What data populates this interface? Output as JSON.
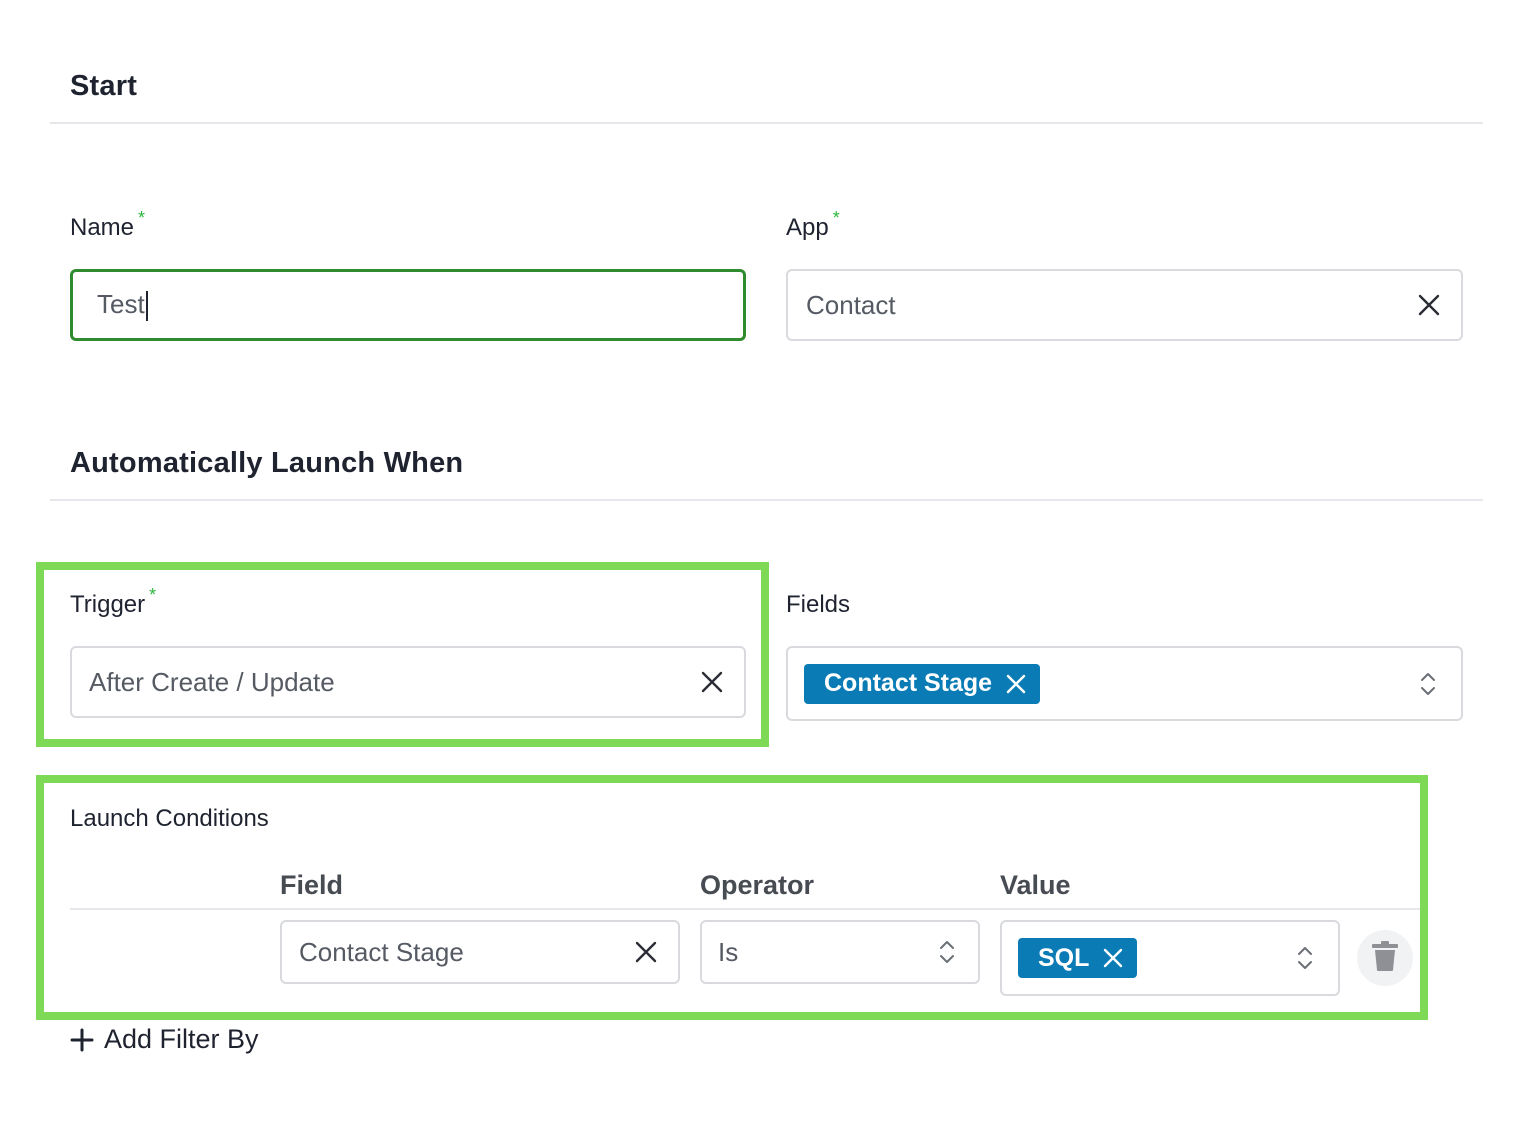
{
  "start": {
    "title": "Start",
    "name": {
      "label": "Name",
      "required": "*",
      "value": "Test"
    },
    "app": {
      "label": "App",
      "required": "*",
      "value": "Contact"
    }
  },
  "launch": {
    "title": "Automatically Launch When",
    "trigger": {
      "label": "Trigger",
      "required": "*",
      "value": "After Create / Update"
    },
    "fields": {
      "label": "Fields",
      "chips": [
        "Contact Stage"
      ]
    }
  },
  "conditions": {
    "title": "Launch Conditions",
    "headers": {
      "field": "Field",
      "operator": "Operator",
      "value": "Value"
    },
    "rows": [
      {
        "field": "Contact Stage",
        "operator": "Is",
        "value_chips": [
          "SQL"
        ]
      }
    ],
    "add_label": "Add Filter By"
  },
  "colors": {
    "accent_green": "#2e8b2e",
    "required_star": "#2db83d",
    "chip_blue": "#0a7bb5",
    "highlight": "#7ed957"
  },
  "icons": [
    "clear-x-icon",
    "chevron-up-down-icon",
    "trash-icon",
    "plus-icon"
  ]
}
